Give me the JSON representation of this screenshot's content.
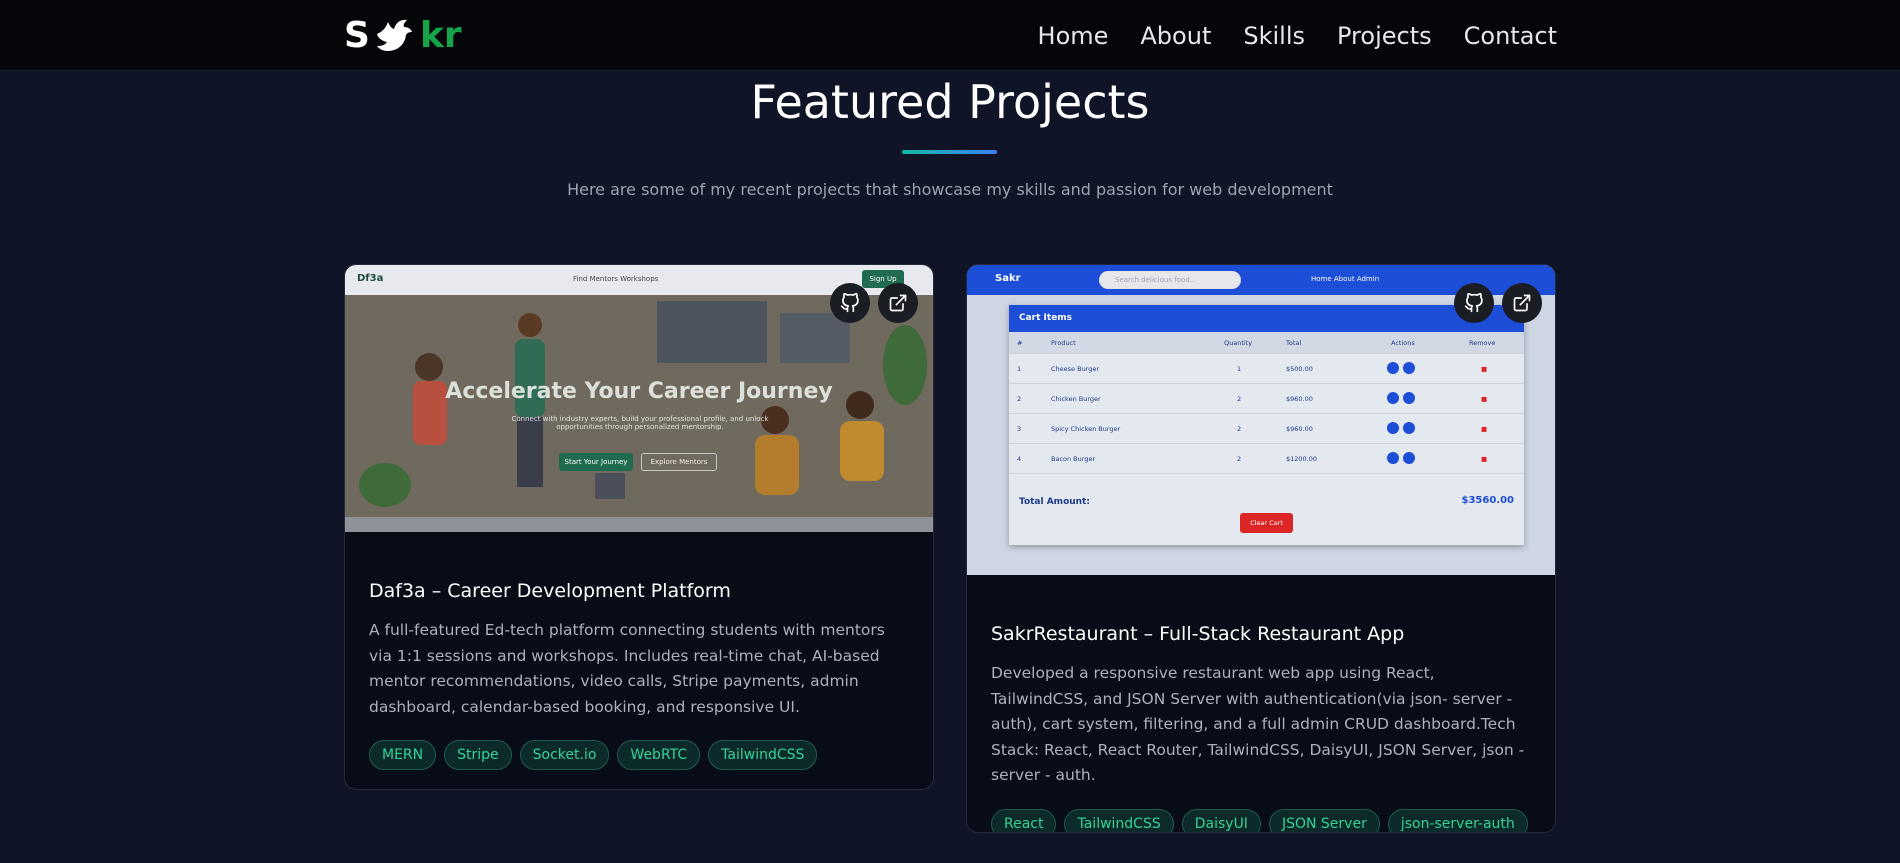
{
  "navbar": {
    "logo": {
      "left": "S",
      "right": "kr"
    },
    "links": [
      "Home",
      "About",
      "Skills",
      "Projects",
      "Contact"
    ]
  },
  "section": {
    "title": "Featured Projects",
    "subtitle": "Here are some of my recent projects that showcase my skills and passion for web development"
  },
  "projects": [
    {
      "title": "Daf3a – Career Development Platform",
      "description": "A full-featured Ed-tech platform connecting students with mentors via 1:1 sessions and workshops. Includes real-time chat, AI-based mentor recommendations, video calls, Stripe payments, admin dashboard, calendar-based booking, and responsive UI.",
      "tags": [
        "MERN",
        "Stripe",
        "Socket.io",
        "WebRTC",
        "TailwindCSS"
      ],
      "preview": {
        "brand": "Df3a",
        "nav": "Find Mentors     Workshops",
        "signup": "Sign Up",
        "heading": "Accelerate Your Career Journey",
        "text": "Connect with industry experts, build your professional profile, and unlock opportunities through personalized mentorship.",
        "cta_primary": "Start Your Journey",
        "cta_secondary": "Explore Mentors"
      }
    },
    {
      "title": "SakrRestaurant – Full-Stack Restaurant App",
      "description": "Developed a responsive restaurant web app using React, TailwindCSS, and JSON Server with authentication(via json- server - auth), cart system, filtering, and a full admin CRUD dashboard.Tech Stack: React, React Router, TailwindCSS, DaisyUI, JSON Server, json - server - auth.",
      "tags": [
        "React",
        "TailwindCSS",
        "DaisyUI",
        "JSON Server",
        "json-server-auth"
      ],
      "preview": {
        "brand": "Sakr",
        "search": "Search delicious food...",
        "nav": "Home     About     Admin",
        "cart_title": "Cart Items",
        "headers": [
          "#",
          "Product",
          "Quantity",
          "Total",
          "Actions",
          "Remove"
        ],
        "rows": [
          [
            "1",
            "Cheese Burger",
            "1",
            "$500.00"
          ],
          [
            "2",
            "Chicken Burger",
            "2",
            "$960.00"
          ],
          [
            "3",
            "Spicy Chicken Burger",
            "2",
            "$960.00"
          ],
          [
            "4",
            "Bacon Burger",
            "2",
            "$1200.00"
          ]
        ],
        "total_label": "Total Amount:",
        "total_value": "$3560.00",
        "clear": "Clear Cart"
      }
    }
  ],
  "colors": {
    "background": "#0f1526",
    "accent_green": "#16a34a",
    "tag_text": "#34d399",
    "underline_start": "#14b8a6",
    "underline_end": "#3b82f6"
  },
  "icons": {
    "github": "github-icon",
    "external": "external-link-icon",
    "bird": "bird-icon"
  }
}
